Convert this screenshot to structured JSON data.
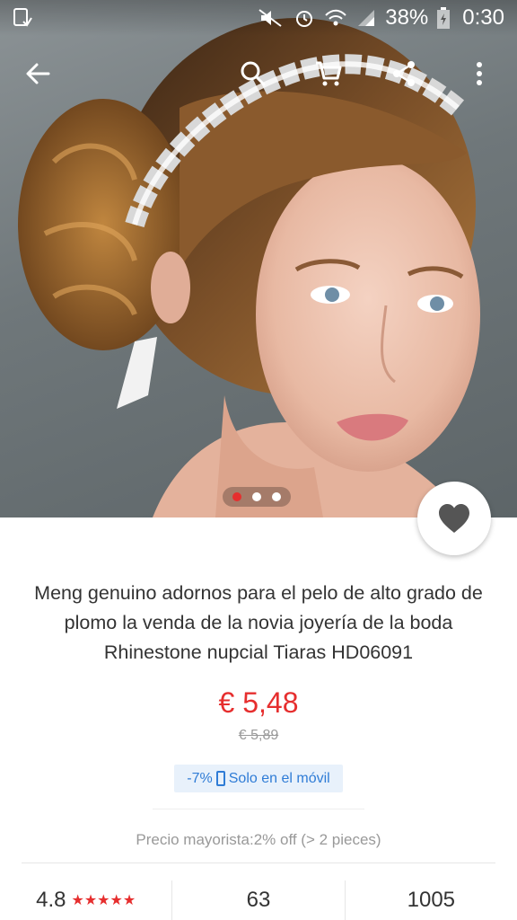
{
  "status_bar": {
    "battery": "38%",
    "time": "0:30",
    "icons": [
      "download-notify-icon",
      "mute-icon",
      "alarm-icon",
      "wifi-icon",
      "signal-icon",
      "battery-charging-icon"
    ]
  },
  "toolbar": {
    "icons": [
      "back-arrow-icon",
      "search-icon",
      "cart-icon",
      "share-icon",
      "more-vert-icon"
    ]
  },
  "gallery": {
    "image_count": 3,
    "active_index": 0
  },
  "favorite": {
    "icon": "heart-icon"
  },
  "product": {
    "title": "Meng genuino adornos para el pelo de alto grado de plomo la venda de la novia joyería de la boda Rhinestone nupcial Tiaras HD06091",
    "price": "€ 5,48",
    "original_price": "€ 5,89",
    "discount": "-7%",
    "mobile_only": "Solo en el móvil",
    "wholesale": "Precio mayorista:2% off (> 2 pieces)"
  },
  "stats": {
    "rating": "4.8",
    "stars": "★★★★★",
    "reviews": "63",
    "orders": "1005"
  },
  "colors": {
    "accent": "#e62e2e",
    "promo_text": "#2f7cd6",
    "promo_bg": "#e8f1fb"
  }
}
